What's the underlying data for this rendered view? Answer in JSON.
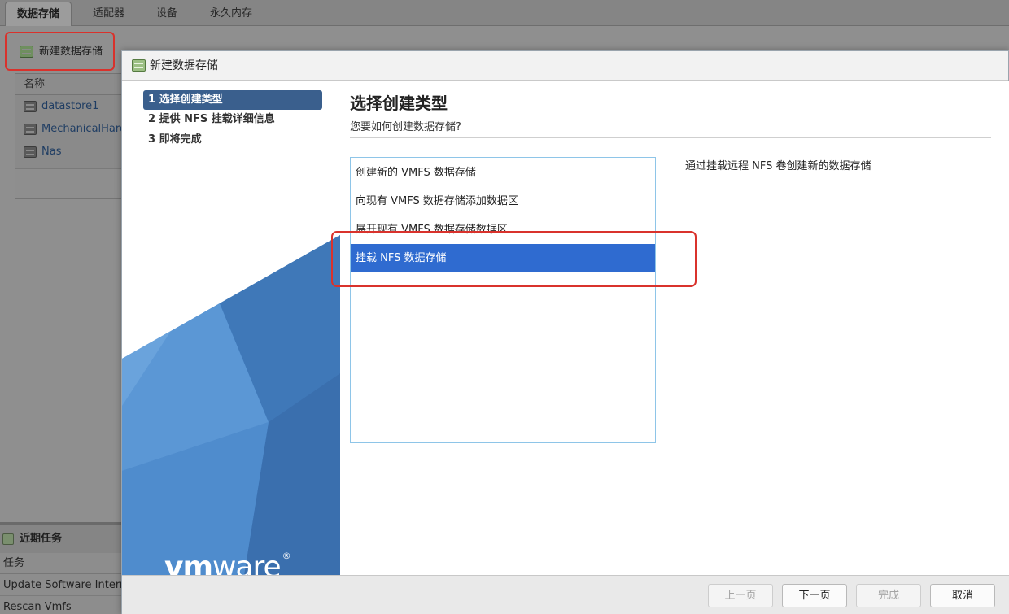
{
  "bg": {
    "tabs": [
      "数据存储",
      "适配器",
      "设备",
      "永久内存"
    ],
    "new_datastore": "新建数据存储",
    "list_header": "名称",
    "datastores": [
      "datastore1",
      "MechanicalHard",
      "Nas"
    ],
    "recent_tasks": "近期任务",
    "tasks_header": "任务",
    "tasks": [
      "Update Software Internet",
      "Rescan Vmfs"
    ]
  },
  "dialog": {
    "title": "新建数据存储",
    "steps": [
      "1 选择创建类型",
      "2 提供 NFS 挂载详细信息",
      "3 即将完成"
    ],
    "active_step": 0,
    "logo": {
      "vm": "vm",
      "ware": "ware",
      "reg": "®"
    },
    "page_title": "选择创建类型",
    "page_subtitle": "您要如何创建数据存储?",
    "options": [
      "创建新的 VMFS 数据存储",
      "向现有 VMFS 数据存储添加数据区",
      "展开现有 VMFS 数据存储数据区",
      "挂载 NFS 数据存储"
    ],
    "selected_option": 3,
    "description": "通过挂载远程 NFS 卷创建新的数据存储",
    "buttons": {
      "prev": "上一页",
      "next": "下一页",
      "finish": "完成",
      "cancel": "取消"
    }
  },
  "colors": {
    "nav_active": "#3a5f8d",
    "selection": "#2f6bd0",
    "highlight_box": "#d9322c",
    "brand_blue": "#4a86c8"
  }
}
